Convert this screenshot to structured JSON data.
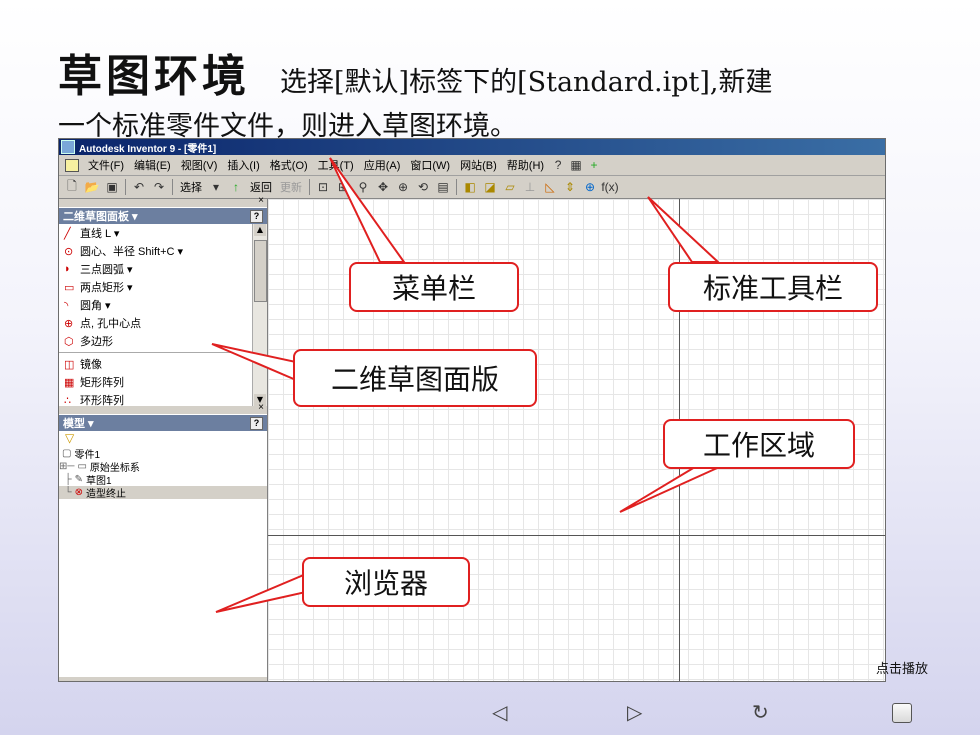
{
  "heading": {
    "big": "草图环境",
    "small": "选择[默认]标签下的[Standard.ipt],新建",
    "line2": "一个标准零件文件，则进入草图环境。"
  },
  "app": {
    "title": "Autodesk Inventor 9 - [零件1]",
    "menu": [
      "文件(F)",
      "编辑(E)",
      "视图(V)",
      "插入(I)",
      "格式(O)",
      "工具(T)",
      "应用(A)",
      "窗口(W)",
      "网站(B)",
      "帮助(H)"
    ],
    "toolbar": {
      "select": "选择",
      "back": "返回",
      "update": "更新"
    },
    "sketch_panel": {
      "title": "二维草图面板 ▾",
      "items": [
        {
          "icon": "╱",
          "label": "直线  L  ▾"
        },
        {
          "icon": "⊙",
          "label": "圆心、半径  Shift+C  ▾"
        },
        {
          "icon": "◗",
          "label": "三点圆弧  ▾"
        },
        {
          "icon": "▭",
          "label": "两点矩形  ▾"
        },
        {
          "icon": "◝",
          "label": "圆角  ▾"
        },
        {
          "icon": "⊕",
          "label": "点, 孔中心点"
        },
        {
          "icon": "⬡",
          "label": "多边形"
        }
      ],
      "items2": [
        {
          "icon": "◫",
          "label": "镜像"
        },
        {
          "icon": "▦",
          "label": "矩形阵列"
        },
        {
          "icon": "∴",
          "label": "环形阵列"
        }
      ]
    },
    "browser": {
      "title": "模型 ▾",
      "items": [
        {
          "indent": "",
          "icon": "▢",
          "label": "零件1"
        },
        {
          "indent": "⊞─",
          "icon": "▭",
          "label": "原始坐标系"
        },
        {
          "indent": "  ├",
          "icon": "✎",
          "label": "草图1"
        },
        {
          "indent": "  └",
          "icon": "⊗",
          "label": "造型终止"
        }
      ]
    }
  },
  "callouts": {
    "menubar": "菜单栏",
    "toolbar": "标准工具栏",
    "panel": "二维草图面版",
    "workarea": "工作区域",
    "browser": "浏览器"
  },
  "controls": {
    "play": "点击播放"
  },
  "colors": {
    "callout_border": "#e02020",
    "titlebar": "#0a246a"
  }
}
